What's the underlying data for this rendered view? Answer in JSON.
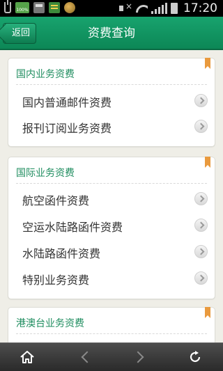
{
  "status_bar": {
    "battery_label": "100%",
    "time": "17:20"
  },
  "header": {
    "back_label": "返回",
    "title": "资费查询"
  },
  "sections": [
    {
      "title": "国内业务资费",
      "items": [
        "国内普通邮件资费",
        "报刊订阅业务资费"
      ]
    },
    {
      "title": "国际业务资费",
      "items": [
        "航空函件资费",
        "空运水陆路函件资费",
        "水陆路函件资费",
        "特别业务资费"
      ]
    },
    {
      "title": "港澳台业务资费",
      "items": []
    }
  ],
  "colors": {
    "header": "#12985f",
    "section_title": "#1f8d5f",
    "bookmark": "#e99a3e",
    "background": "#efeee7"
  },
  "icons": {
    "home": "home-icon",
    "back": "back-arrow-icon",
    "forward": "forward-arrow-icon",
    "refresh": "refresh-icon"
  }
}
